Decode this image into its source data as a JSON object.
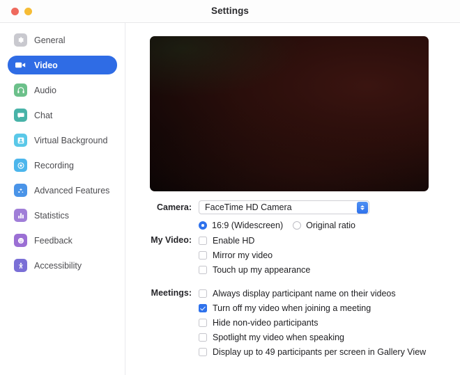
{
  "window": {
    "title": "Settings",
    "traffic_lights": [
      {
        "name": "close",
        "color": "#ef6a5e"
      },
      {
        "name": "minimize",
        "color": "#f6bc35"
      }
    ]
  },
  "sidebar": {
    "items": [
      {
        "label": "General",
        "icon": "gear-icon",
        "icon_color": "#c9c9cf",
        "selected": false
      },
      {
        "label": "Video",
        "icon": "video-camera-icon",
        "icon_color": "#ffffff",
        "selected": true
      },
      {
        "label": "Audio",
        "icon": "headphones-icon",
        "icon_color": "#6cc08a",
        "selected": false
      },
      {
        "label": "Chat",
        "icon": "chat-bubble-icon",
        "icon_color": "#48b3a8",
        "selected": false
      },
      {
        "label": "Virtual Background",
        "icon": "person-frame-icon",
        "icon_color": "#5ac8e8",
        "selected": false
      },
      {
        "label": "Recording",
        "icon": "record-circle-icon",
        "icon_color": "#4cb6ec",
        "selected": false
      },
      {
        "label": "Advanced Features",
        "icon": "sparkle-icon",
        "icon_color": "#4a94e8",
        "selected": false
      },
      {
        "label": "Statistics",
        "icon": "bar-chart-icon",
        "icon_color": "#a07ed8",
        "selected": false
      },
      {
        "label": "Feedback",
        "icon": "smiley-face-icon",
        "icon_color": "#9b6fd4",
        "selected": false
      },
      {
        "label": "Accessibility",
        "icon": "accessibility-person-icon",
        "icon_color": "#7a6fd6",
        "selected": false
      }
    ],
    "selected_accent": "#2f6ce5"
  },
  "main": {
    "video_preview": {
      "name": "camera-preview",
      "description": "dark camera preview"
    },
    "camera": {
      "label": "Camera:",
      "selected": "FaceTime HD Camera",
      "options": [
        "FaceTime HD Camera"
      ],
      "aspect_ratio": {
        "options": [
          {
            "label": "16:9 (Widescreen)",
            "checked": true
          },
          {
            "label": "Original ratio",
            "checked": false
          }
        ]
      }
    },
    "my_video": {
      "label": "My Video:",
      "options": [
        {
          "label": "Enable HD",
          "checked": false
        },
        {
          "label": "Mirror my video",
          "checked": false
        },
        {
          "label": "Touch up my appearance",
          "checked": false
        }
      ]
    },
    "meetings": {
      "label": "Meetings:",
      "options": [
        {
          "label": "Always display participant name on their videos",
          "checked": false
        },
        {
          "label": "Turn off my video when joining a meeting",
          "checked": true
        },
        {
          "label": "Hide non-video participants",
          "checked": false
        },
        {
          "label": "Spotlight my video when speaking",
          "checked": false
        },
        {
          "label": "Display up to 49 participants per screen in Gallery View",
          "checked": false
        }
      ]
    }
  }
}
